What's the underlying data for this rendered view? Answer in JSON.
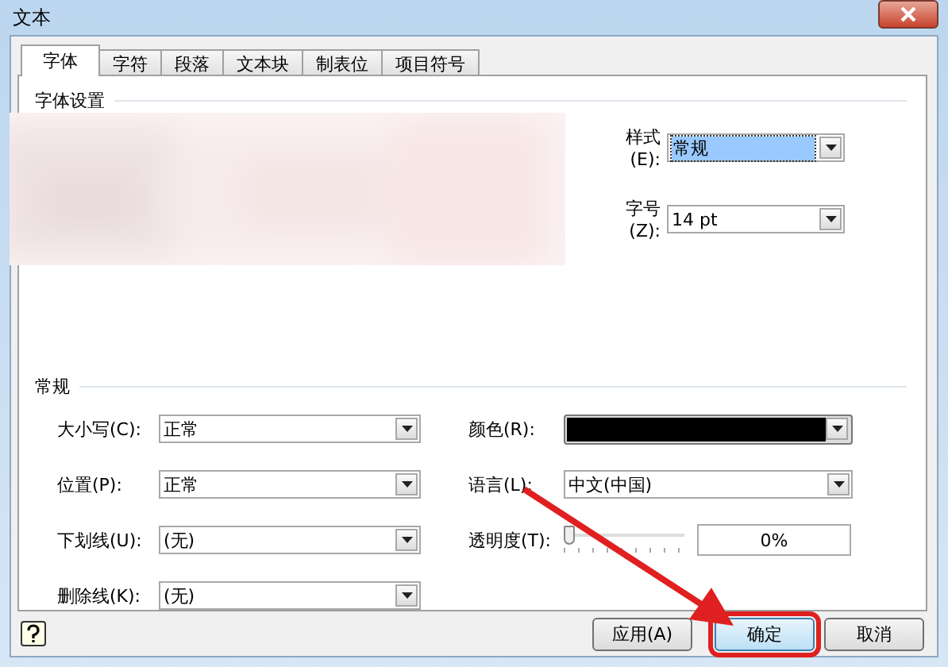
{
  "window": {
    "title": "文本"
  },
  "tabs": [
    {
      "label": "字体",
      "selected": true
    },
    {
      "label": "字符",
      "selected": false
    },
    {
      "label": "段落",
      "selected": false
    },
    {
      "label": "文本块",
      "selected": false
    },
    {
      "label": "制表位",
      "selected": false
    },
    {
      "label": "项目符号",
      "selected": false
    }
  ],
  "font_settings": {
    "label": "字体设置",
    "fields": [
      {
        "label": "样式(E):",
        "value": "常规",
        "selected": true
      },
      {
        "label": "字号(Z):",
        "value": "14 pt",
        "selected": false
      }
    ]
  },
  "general": {
    "label": "常规",
    "left": [
      {
        "kind": "combo",
        "label": "大小写(C):",
        "value": "正常"
      },
      {
        "kind": "combo",
        "label": "位置(P):",
        "value": "正常"
      },
      {
        "kind": "combo",
        "label": "下划线(U):",
        "value": "(无)"
      },
      {
        "kind": "combo",
        "label": "删除线(K):",
        "value": "(无)"
      }
    ],
    "right": [
      {
        "kind": "color",
        "label": "颜色(R):",
        "color": "#000000"
      },
      {
        "kind": "combo",
        "label": "语言(L):",
        "value": "中文(中国)"
      },
      {
        "kind": "slider",
        "label": "透明度(T):",
        "level": 0,
        "reading": "0%"
      }
    ]
  },
  "buttons": [
    {
      "label": "应用(A)",
      "highlighted": false
    },
    {
      "label": "确定",
      "highlighted": true
    },
    {
      "label": "取消",
      "highlighted": false
    }
  ]
}
